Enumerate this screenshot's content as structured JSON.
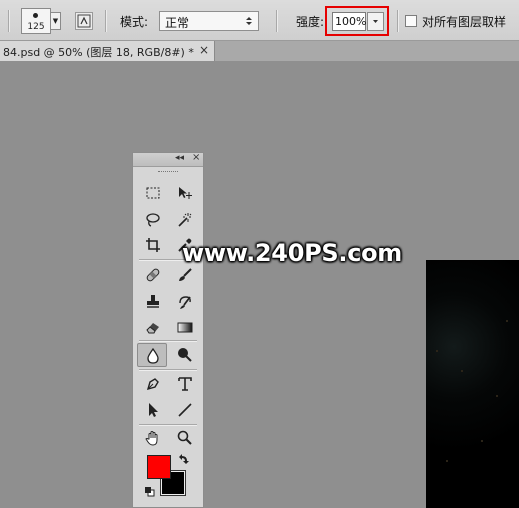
{
  "options_bar": {
    "brush_size": "125",
    "mode_label": "模式:",
    "mode_value": "正常",
    "strength_label": "强度:",
    "strength_value": "100%",
    "sample_all_layers_label": "对所有图层取样"
  },
  "document_tab": {
    "title": "84.psd @ 50% (图层 18, RGB/8#) *",
    "close_glyph": "×"
  },
  "toolbox": {
    "collapse_glyph": "◂◂",
    "close_glyph": "×",
    "active_tool": "blur-tool",
    "foreground_color": "#ff0000",
    "background_color": "#000000",
    "tools": [
      "rectangular-marquee",
      "move",
      "lasso",
      "quick-selection",
      "crop",
      "eyedropper",
      "spot-healing-brush",
      "brush",
      "clone-stamp",
      "history-brush",
      "eraser",
      "gradient",
      "blur",
      "dodge",
      "pen",
      "type",
      "path-selection",
      "line",
      "hand",
      "zoom"
    ]
  },
  "watermark": "www.240PS.com",
  "colors": {
    "workspace": "#8f8f8f",
    "highlight": "#e60000"
  }
}
